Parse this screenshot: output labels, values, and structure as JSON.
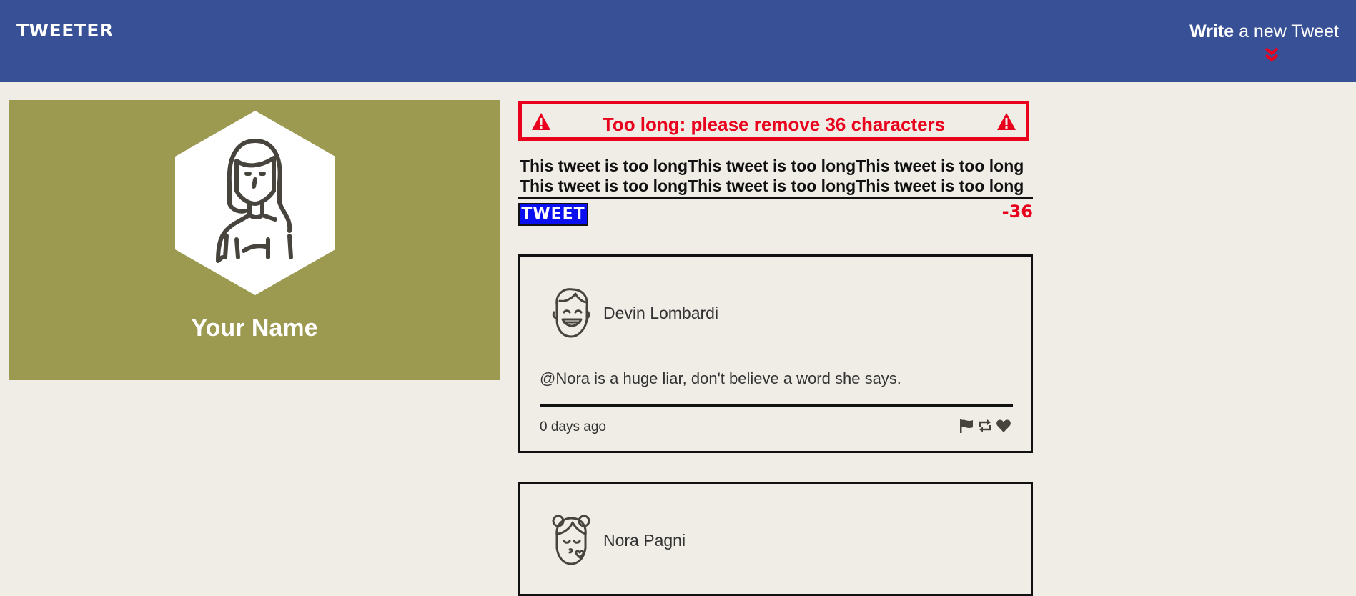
{
  "navbar": {
    "brand": "TWEETER",
    "compose_bold": "Write",
    "compose_rest": " a new Tweet",
    "compose_arrow_icon": "double-chevron-down-icon",
    "accent_color": "#e8001d",
    "background_color": "#385196"
  },
  "profile": {
    "name": "Your Name",
    "avatar_icon": "woman-avatar-icon",
    "background_color": "#9c9a50"
  },
  "composer": {
    "error_message": "Too long: please remove 36 characters",
    "warning_icon": "warning-triangle-icon",
    "text": "This tweet is too longThis tweet is too longThis tweet is too longThis tweet is too longThis tweet is too longThis tweet is too longThis",
    "button_label": "TWEET",
    "counter": "-36"
  },
  "tweets": [
    {
      "author": "Devin Lombardi",
      "avatar_icon": "laughing-man-avatar-icon",
      "body": "@Nora is a huge liar, don't believe a word she says.",
      "time": "0 days ago",
      "actions": [
        "flag-icon",
        "retweet-icon",
        "heart-icon"
      ]
    },
    {
      "author": "Nora Pagni",
      "avatar_icon": "kissing-woman-avatar-icon"
    }
  ]
}
